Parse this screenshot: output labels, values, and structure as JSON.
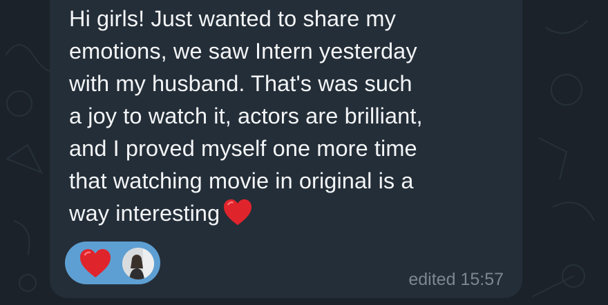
{
  "message": {
    "text": "Hi girls! Just wanted to share my\nemotions, we saw Intern yesterday\nwith my husband. That's was such\na joy to watch it, actors are brilliant,\nand I proved myself one more time\nthat watching movie in original is a\nway interesting",
    "trailing_emoji": "red-heart-icon",
    "status": "edited",
    "time": "15:57"
  },
  "reactions": [
    {
      "emoji": "red-heart-icon",
      "reactor": "user-avatar"
    }
  ],
  "colors": {
    "background": "#1b2229",
    "bubble": "#242e38",
    "text": "#f3f5f7",
    "meta": "#7d8792",
    "reaction_pill": "#5e9fd3",
    "heart": "#e0242c"
  }
}
